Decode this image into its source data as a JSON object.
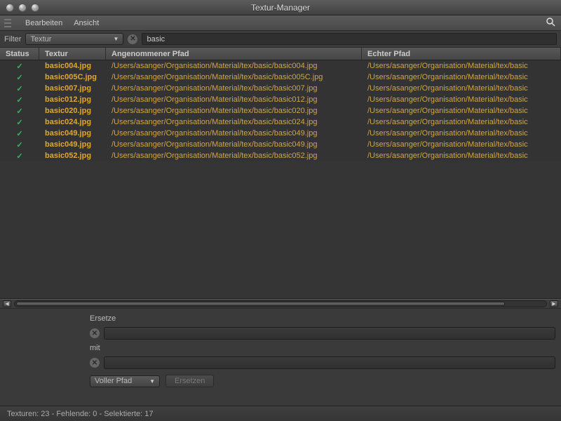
{
  "window": {
    "title": "Textur-Manager"
  },
  "menubar": {
    "edit": "Bearbeiten",
    "view": "Ansicht"
  },
  "filter": {
    "label": "Filter",
    "dropdown_value": "Textur",
    "search_value": "basic"
  },
  "columns": {
    "status": "Status",
    "texture": "Textur",
    "assumed_path": "Angenommener Pfad",
    "real_path": "Echter Pfad"
  },
  "rows": [
    {
      "ok": "✓",
      "tex": "basic004.jpg",
      "apath": "/Users/asanger/Organisation/Material/tex/basic/basic004.jpg",
      "epath": "/Users/asanger/Organisation/Material/tex/basic"
    },
    {
      "ok": "✓",
      "tex": "basic005C.jpg",
      "apath": "/Users/asanger/Organisation/Material/tex/basic/basic005C.jpg",
      "epath": "/Users/asanger/Organisation/Material/tex/basic"
    },
    {
      "ok": "✓",
      "tex": "basic007.jpg",
      "apath": "/Users/asanger/Organisation/Material/tex/basic/basic007.jpg",
      "epath": "/Users/asanger/Organisation/Material/tex/basic"
    },
    {
      "ok": "✓",
      "tex": "basic012.jpg",
      "apath": "/Users/asanger/Organisation/Material/tex/basic/basic012.jpg",
      "epath": "/Users/asanger/Organisation/Material/tex/basic"
    },
    {
      "ok": "✓",
      "tex": "basic020.jpg",
      "apath": "/Users/asanger/Organisation/Material/tex/basic/basic020.jpg",
      "epath": "/Users/asanger/Organisation/Material/tex/basic"
    },
    {
      "ok": "✓",
      "tex": "basic024.jpg",
      "apath": "/Users/asanger/Organisation/Material/tex/basic/basic024.jpg",
      "epath": "/Users/asanger/Organisation/Material/tex/basic"
    },
    {
      "ok": "✓",
      "tex": "basic049.jpg",
      "apath": "/Users/asanger/Organisation/Material/tex/basic/basic049.jpg",
      "epath": "/Users/asanger/Organisation/Material/tex/basic"
    },
    {
      "ok": "✓",
      "tex": "basic049.jpg",
      "apath": "/Users/asanger/Organisation/Material/tex/basic/basic049.jpg",
      "epath": "/Users/asanger/Organisation/Material/tex/basic"
    },
    {
      "ok": "✓",
      "tex": "basic052.jpg",
      "apath": "/Users/asanger/Organisation/Material/tex/basic/basic052.jpg",
      "epath": "/Users/asanger/Organisation/Material/tex/basic"
    }
  ],
  "replace": {
    "title": "Ersetze",
    "with": "mit",
    "mode": "Voller Pfad",
    "button": "Ersetzen"
  },
  "status": "Texturen: 23 - Fehlende: 0 - Selektierte: 17"
}
